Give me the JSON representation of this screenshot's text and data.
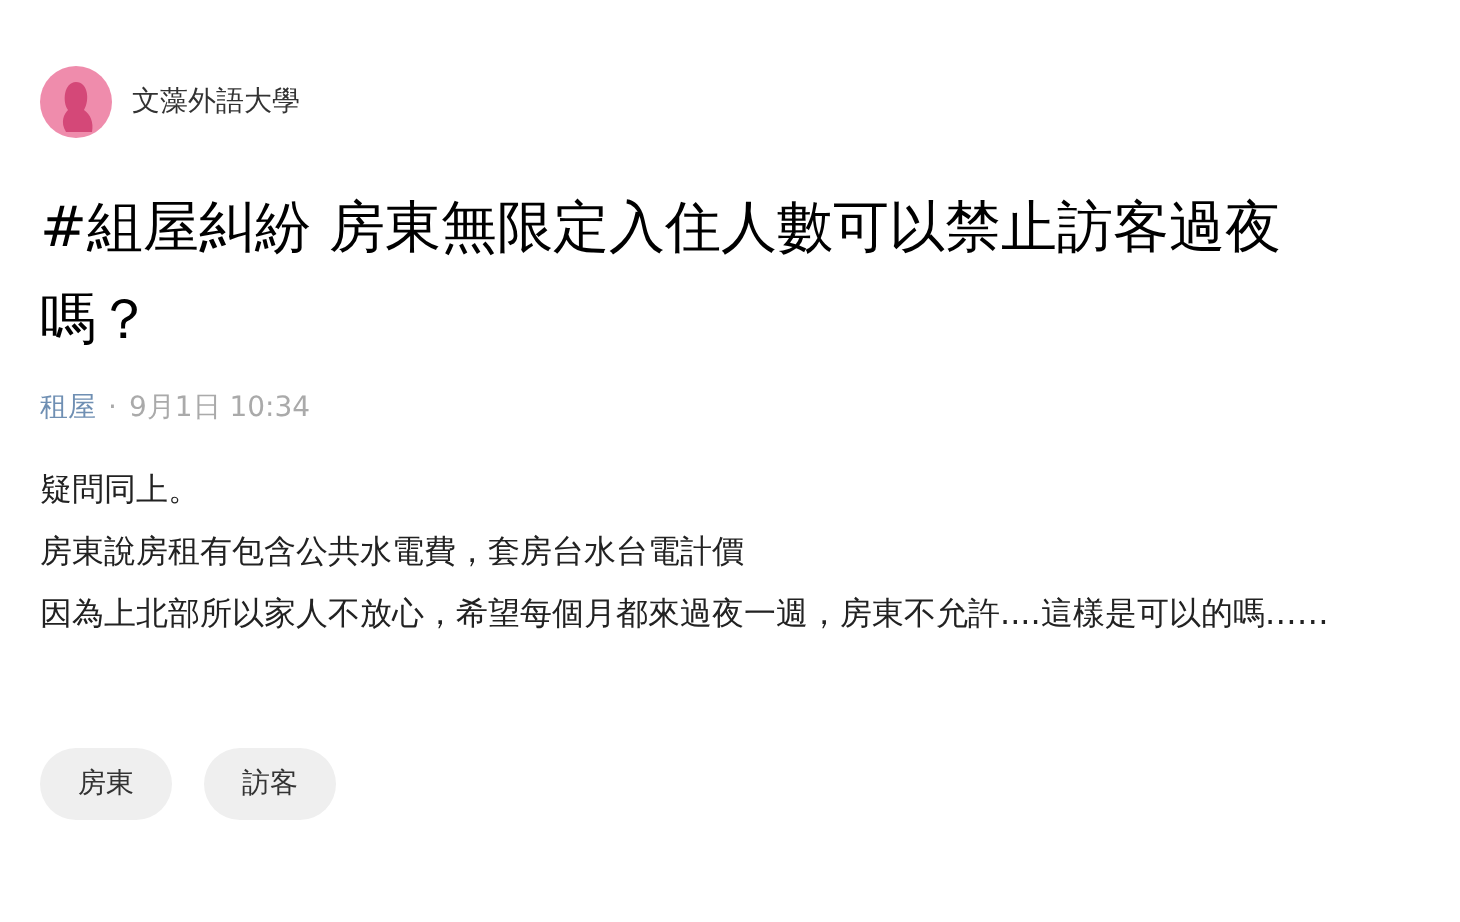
{
  "author": {
    "name": "文藻外語大學"
  },
  "post": {
    "title": "#組屋糾紛 房東無限定入住人數可以禁止訪客過夜嗎？",
    "category": "租屋",
    "separator": "·",
    "time": "9月1日 10:34",
    "body": [
      "疑問同上。",
      "房東說房租有包含公共水電費，套房台水台電計價",
      "因為上北部所以家人不放心，希望每個月都來過夜一週，房東不允許....這樣是可以的嗎……"
    ]
  },
  "tags": [
    "房東",
    "訪客"
  ]
}
